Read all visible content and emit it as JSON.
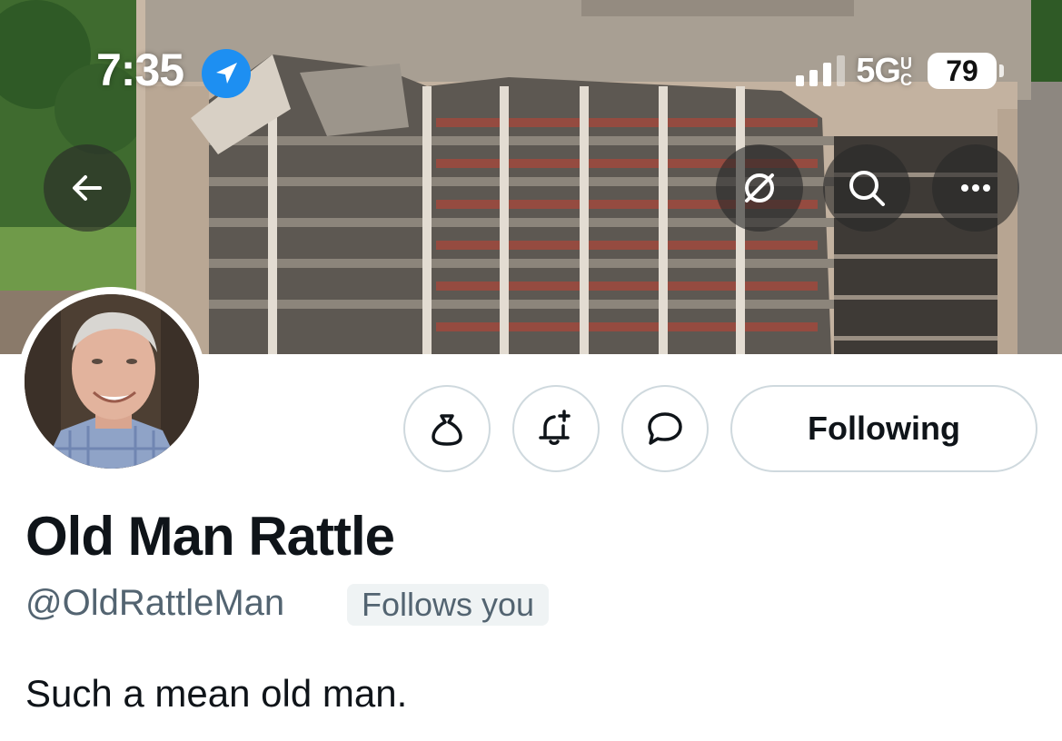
{
  "status_bar": {
    "time": "7:35",
    "network": "5G",
    "network_suffix": "UC",
    "battery": "79"
  },
  "banner": {
    "description_icon": "building-photo"
  },
  "header_buttons": {
    "back": "arrow-left-icon",
    "translate": "no-symbol-icon",
    "search": "search-icon",
    "more": "more-icon"
  },
  "actions": {
    "tip_icon": "money-bag-icon",
    "notify_icon": "bell-plus-icon",
    "message_icon": "chat-bubble-icon",
    "following_label": "Following"
  },
  "profile": {
    "display_name": "Old Man Rattle",
    "handle": "@OldRattleMan",
    "follows_you": "Follows you",
    "bio": "Such a mean old man."
  },
  "colors": {
    "accent": "#1d9bf0",
    "text": "#0f1419",
    "muted": "#536471",
    "border": "#cfd9de"
  }
}
